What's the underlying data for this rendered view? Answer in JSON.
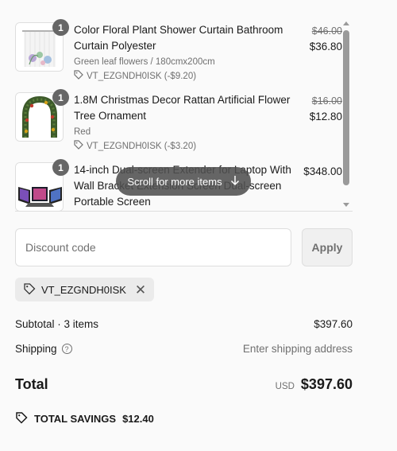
{
  "items": [
    {
      "quantity": "1",
      "name": "Color Floral Plant Shower Curtain Bathroom Curtain Polyester",
      "variant": "Green leaf flowers / 180cmx200cm",
      "discount": "VT_EZGNDH0ISK (-$9.20)",
      "original_price": "$46.00",
      "price": "$36.80"
    },
    {
      "quantity": "1",
      "name": "1.8M Christmas Decor Rattan Artificial Flower Tree Ornament",
      "variant": "Red",
      "discount": "VT_EZGNDH0ISK (-$3.20)",
      "original_price": "$16.00",
      "price": "$12.80"
    },
    {
      "quantity": "1",
      "name": "14-inch Dual-screen Extender for Laptop With Wall Bracket Extension Screen Dual-screen Portable Screen",
      "price": "$348.00"
    }
  ],
  "scroll_hint": "Scroll for more items",
  "discount": {
    "placeholder": "Discount code",
    "apply_label": "Apply",
    "applied_code": "VT_EZGNDH0ISK"
  },
  "summary": {
    "subtotal_label": "Subtotal · 3 items",
    "subtotal_value": "$397.60",
    "shipping_label": "Shipping",
    "shipping_value": "Enter shipping address",
    "total_label": "Total",
    "currency": "USD",
    "total_value": "$397.60",
    "savings_label": "TOTAL SAVINGS",
    "savings_value": "$12.40"
  },
  "icons": {
    "tag": "tag-icon",
    "help": "question-circle-icon",
    "close": "close-icon",
    "arrow": "arrow-down-icon"
  }
}
